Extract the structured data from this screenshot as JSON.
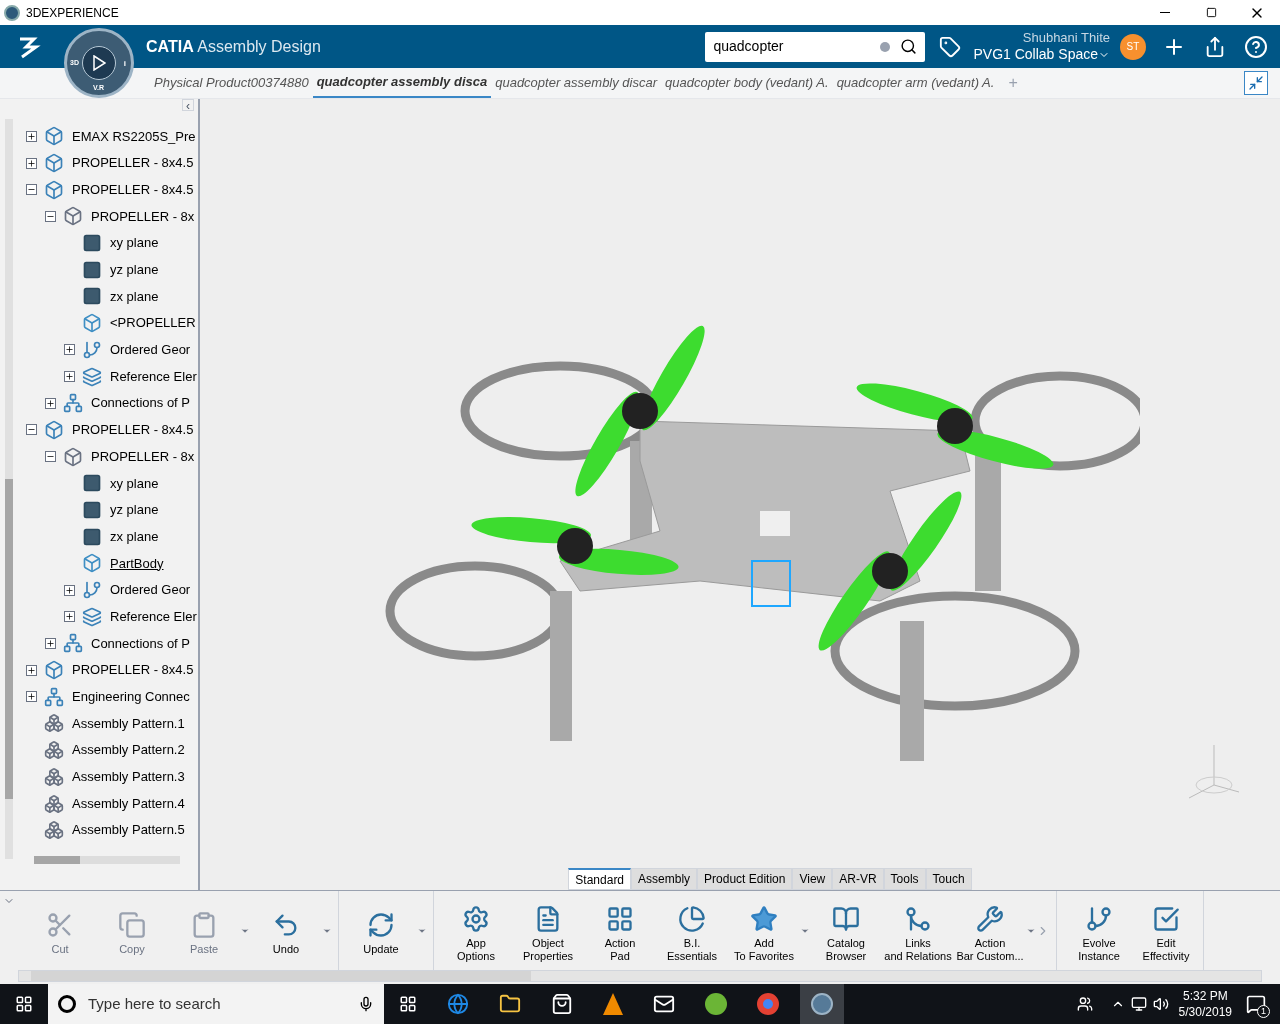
{
  "window": {
    "title": "3DEXPERIENCE"
  },
  "header": {
    "brand": "CATIA",
    "app": "Assembly Design",
    "compass_labels": [
      "3D",
      "V.R",
      "i"
    ],
    "search": {
      "value": "quadcopter"
    },
    "user": "Shubhani Thite",
    "space": "PVG1 Collab Space",
    "avatar": "ST"
  },
  "doc_tabs": [
    {
      "label": "Physical Product00374880",
      "selected": false
    },
    {
      "label": "quadcopter assembly disca",
      "selected": true
    },
    {
      "label": "quadcopter assembly discar",
      "selected": false
    },
    {
      "label": "quadcopter body (vedant) A.",
      "selected": false
    },
    {
      "label": "quadcopter arm (vedant) A.",
      "selected": false
    }
  ],
  "doc_tabs_add": "+",
  "tree": {
    "collapse": "‹",
    "items": [
      {
        "label": "EMAX RS2205S_Pre",
        "kind": "product",
        "expanded": false
      },
      {
        "label": "PROPELLER - 8x4.5",
        "kind": "product",
        "expanded": false
      },
      {
        "label": "PROPELLER - 8x4.5",
        "kind": "product",
        "expanded": true,
        "children": [
          {
            "label": "PROPELLER - 8x",
            "kind": "part",
            "expanded": true,
            "children": [
              {
                "label": "xy plane",
                "kind": "plane"
              },
              {
                "label": "yz plane",
                "kind": "plane"
              },
              {
                "label": "zx plane",
                "kind": "plane"
              },
              {
                "label": "<PROPELLER",
                "kind": "body",
                "current": false
              },
              {
                "label": "Ordered Geor",
                "kind": "geometry",
                "expanded": false
              },
              {
                "label": "Reference Eler",
                "kind": "reference",
                "expanded": false
              }
            ]
          },
          {
            "label": "Connections of P",
            "kind": "connections",
            "expanded": false
          }
        ]
      },
      {
        "label": "PROPELLER - 8x4.5",
        "kind": "product",
        "expanded": true,
        "children": [
          {
            "label": "PROPELLER - 8x",
            "kind": "part",
            "expanded": true,
            "children": [
              {
                "label": "xy plane",
                "kind": "plane"
              },
              {
                "label": "yz plane",
                "kind": "plane"
              },
              {
                "label": "zx plane",
                "kind": "plane"
              },
              {
                "label": "PartBody",
                "kind": "body",
                "current": true
              },
              {
                "label": "Ordered Geor",
                "kind": "geometry",
                "expanded": false
              },
              {
                "label": "Reference Eler",
                "kind": "reference",
                "expanded": false
              }
            ]
          },
          {
            "label": "Connections of P",
            "kind": "connections",
            "expanded": false
          }
        ]
      },
      {
        "label": "PROPELLER - 8x4.5",
        "kind": "product",
        "expanded": false
      },
      {
        "label": "Engineering Connec",
        "kind": "connections",
        "expanded": false
      },
      {
        "label": "Assembly Pattern.1",
        "kind": "pattern"
      },
      {
        "label": "Assembly Pattern.2",
        "kind": "pattern"
      },
      {
        "label": "Assembly Pattern.3",
        "kind": "pattern"
      },
      {
        "label": "Assembly Pattern.4",
        "kind": "pattern"
      },
      {
        "label": "Assembly Pattern.5",
        "kind": "pattern"
      }
    ]
  },
  "action_tabs": [
    {
      "label": "Standard",
      "selected": true
    },
    {
      "label": "Assembly",
      "selected": false
    },
    {
      "label": "Product Edition",
      "selected": false
    },
    {
      "label": "View",
      "selected": false
    },
    {
      "label": "AR-VR",
      "selected": false
    },
    {
      "label": "Tools",
      "selected": false
    },
    {
      "label": "Touch",
      "selected": false
    }
  ],
  "action_groups": [
    [
      {
        "lines": [
          "Cut"
        ],
        "kind": "cut",
        "disabled": true,
        "dropdown": false
      },
      {
        "lines": [
          "Copy"
        ],
        "kind": "copy",
        "disabled": true,
        "dropdown": false
      },
      {
        "lines": [
          "Paste"
        ],
        "kind": "paste",
        "disabled": true,
        "dropdown": true
      },
      {
        "lines": [
          "Undo"
        ],
        "kind": "undo",
        "disabled": false,
        "dropdown": true
      }
    ],
    [
      {
        "lines": [
          "Update"
        ],
        "kind": "update",
        "disabled": false,
        "dropdown": true
      }
    ],
    [
      {
        "lines": [
          "App",
          "Options"
        ],
        "kind": "options",
        "disabled": false,
        "dropdown": false
      },
      {
        "lines": [
          "Object",
          "Properties"
        ],
        "kind": "properties",
        "disabled": false,
        "dropdown": false
      },
      {
        "lines": [
          "Action",
          "Pad"
        ],
        "kind": "pad",
        "disabled": false,
        "dropdown": false
      },
      {
        "lines": [
          "B.I.",
          "Essentials"
        ],
        "kind": "bi",
        "disabled": false,
        "dropdown": false
      },
      {
        "lines": [
          "Add",
          "To Favorites"
        ],
        "kind": "star",
        "disabled": false,
        "dropdown": true
      },
      {
        "lines": [
          "Catalog",
          "Browser"
        ],
        "kind": "catalog",
        "disabled": false,
        "dropdown": false
      },
      {
        "lines": [
          "Links",
          "and Relations"
        ],
        "kind": "links",
        "disabled": false,
        "dropdown": false
      },
      {
        "lines": [
          "Action",
          "Bar Custom..."
        ],
        "kind": "custom",
        "disabled": false,
        "dropdown": true
      }
    ],
    [
      {
        "lines": [
          "Evolve",
          "Instance"
        ],
        "kind": "evolve",
        "disabled": false,
        "dropdown": false
      },
      {
        "lines": [
          "Edit",
          "Effectivity"
        ],
        "kind": "effectivity",
        "disabled": false,
        "dropdown": false
      }
    ]
  ],
  "taskbar": {
    "search_placeholder": "Type here to search",
    "time": "5:32 PM",
    "date": "5/30/2019",
    "notifications": "1"
  }
}
